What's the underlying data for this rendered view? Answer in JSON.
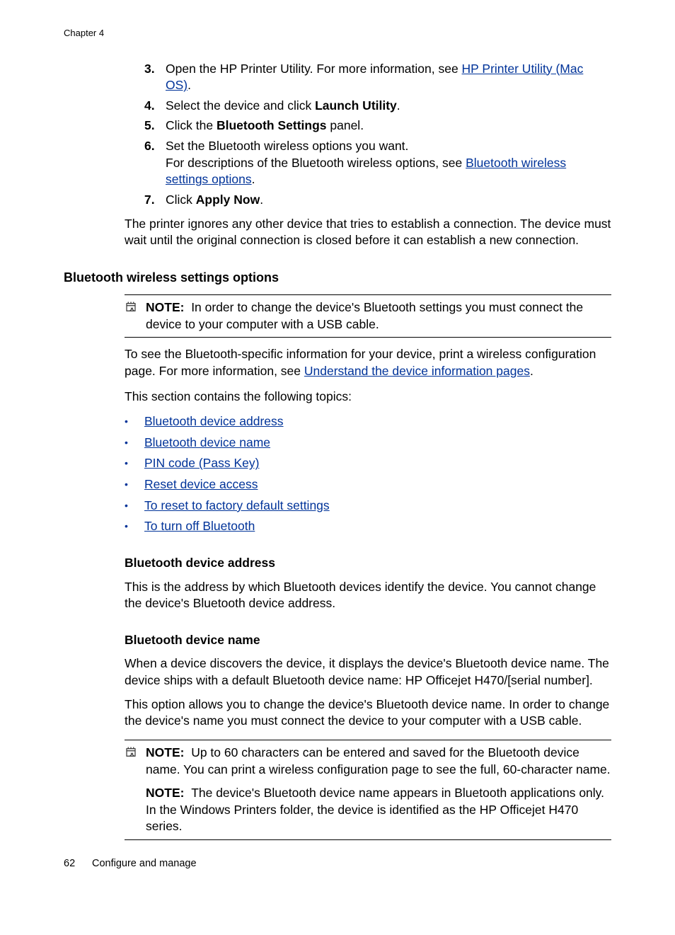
{
  "chapterHeader": "Chapter 4",
  "steps": {
    "s3": {
      "num": "3.",
      "pre": "Open the HP Printer Utility. For more information, see ",
      "link": "HP Printer Utility (Mac OS)",
      "post": "."
    },
    "s4": {
      "num": "4.",
      "pre": "Select the device and click ",
      "bold": "Launch Utility",
      "post": "."
    },
    "s5": {
      "num": "5.",
      "pre": "Click the ",
      "bold": "Bluetooth Settings",
      "post": " panel."
    },
    "s6": {
      "num": "6.",
      "line1": "Set the Bluetooth wireless options you want.",
      "line2pre": "For descriptions of the Bluetooth wireless options, see ",
      "line2link": "Bluetooth wireless settings options",
      "line2post": "."
    },
    "s7": {
      "num": "7.",
      "pre": "Click ",
      "bold": "Apply Now",
      "post": "."
    }
  },
  "afterStepsPara": "The printer ignores any other device that tries to establish a connection. The device must wait until the original connection is closed before it can establish a new connection.",
  "sectionHeading": "Bluetooth wireless settings options",
  "note1": {
    "label": "NOTE:",
    "body": "In order to change the device's Bluetooth settings you must connect the device to your computer with a USB cable."
  },
  "para1": {
    "pre": "To see the Bluetooth-specific information for your device, print a wireless configuration page. For more information, see ",
    "link": "Understand the device information pages",
    "post": "."
  },
  "para2": "This section contains the following topics:",
  "topics": [
    "Bluetooth device address",
    "Bluetooth device name",
    "PIN code (Pass Key)",
    "Reset device access",
    "To reset to factory default settings",
    "To turn off Bluetooth"
  ],
  "subA": {
    "heading": "Bluetooth device address",
    "para": "This is the address by which Bluetooth devices identify the device. You cannot change the device's Bluetooth device address."
  },
  "subB": {
    "heading": "Bluetooth device name",
    "para1": "When a device discovers the device, it displays the device's Bluetooth device name. The device ships with a default Bluetooth device name: HP Officejet H470/[serial number].",
    "para2": "This option allows you to change the device's Bluetooth device name. In order to change the device's name you must connect the device to your computer with a USB cable."
  },
  "note2a": {
    "label": "NOTE:",
    "body": "Up to 60 characters can be entered and saved for the Bluetooth device name. You can print a wireless configuration page to see the full, 60-character name."
  },
  "note2b": {
    "label": "NOTE:",
    "body": "The device's Bluetooth device name appears in Bluetooth applications only. In the Windows Printers folder, the device is identified as the HP Officejet H470 series."
  },
  "footer": {
    "pageNum": "62",
    "title": "Configure and manage"
  }
}
